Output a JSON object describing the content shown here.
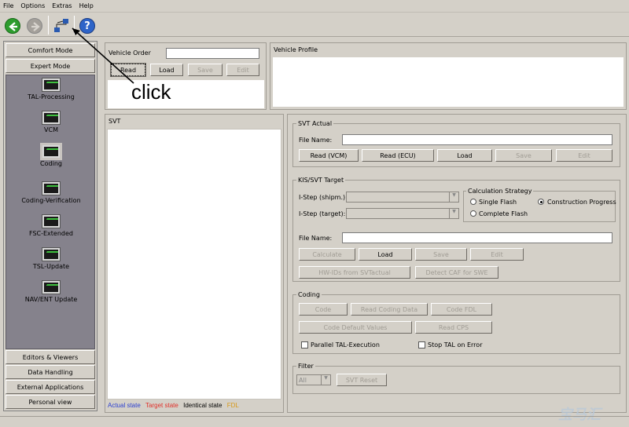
{
  "menu": [
    "File",
    "Options",
    "Extras",
    "Help"
  ],
  "sidebar": {
    "comfort": "Comfort Mode",
    "expert": "Expert Mode",
    "modules": [
      "TAL-Processing",
      "VCM",
      "Coding",
      "Coding-Verification",
      "FSC-Extended",
      "TSL-Update",
      "NAV/ENT Update"
    ],
    "bottom": [
      "Editors & Viewers",
      "Data Handling",
      "External Applications",
      "Personal view"
    ]
  },
  "vehicle_order": {
    "title": "Vehicle Order",
    "read": "Read",
    "load": "Load",
    "save": "Save",
    "edit": "Edit"
  },
  "vehicle_profile": {
    "title": "Vehicle Profile"
  },
  "annotation": "click",
  "svt": {
    "title": "SVT"
  },
  "legend": {
    "actual": "Actual state",
    "target": "Target state",
    "identical": "Identical state",
    "fdl": "FDL"
  },
  "svt_actual": {
    "title": "SVT Actual",
    "file_name": "File Name:",
    "read_vcm": "Read (VCM)",
    "read_ecu": "Read (ECU)",
    "load": "Load",
    "save": "Save",
    "edit": "Edit"
  },
  "kis": {
    "title": "KIS/SVT Target",
    "istep_shipm": "I-Step (shipm.):",
    "istep_target": "I-Step (target):",
    "calc_title": "Calculation Strategy",
    "single": "Single Flash",
    "complete": "Complete Flash",
    "construction": "Construction Progress",
    "file_name": "File Name:",
    "calculate": "Calculate",
    "load": "Load",
    "save": "Save",
    "edit": "Edit",
    "hw_ids": "HW-IDs from SVTactual",
    "detect": "Detect CAF for SWE"
  },
  "coding": {
    "title": "Coding",
    "code": "Code",
    "read_coding": "Read Coding Data",
    "code_fdl": "Code FDL",
    "code_default": "Code Default Values",
    "read_cps": "Read CPS",
    "parallel": "Parallel TAL-Execution",
    "stop": "Stop TAL on Error"
  },
  "filter": {
    "title": "Filter",
    "value": "All",
    "svt_reset": "SVT Reset"
  },
  "colors": {
    "actual": "#2b3fd0",
    "target": "#e0302a",
    "identical": "#000000",
    "fdl": "#d89a1a"
  },
  "watermark": "宝马汇"
}
